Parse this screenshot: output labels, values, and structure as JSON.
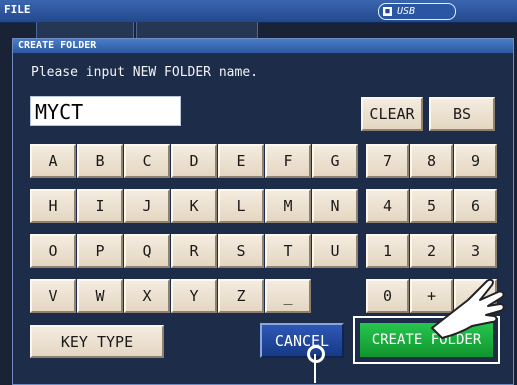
{
  "topbar": {
    "title": "FILE",
    "storage_label": "USB",
    "storage_icon": "usb-drive-icon"
  },
  "dialog": {
    "title": "CREATE FOLDER",
    "prompt": "Please input NEW FOLDER name.",
    "name_value": "MYCT"
  },
  "keys": {
    "letters": [
      "A",
      "B",
      "C",
      "D",
      "E",
      "F",
      "G",
      "H",
      "I",
      "J",
      "K",
      "L",
      "M",
      "N",
      "O",
      "P",
      "Q",
      "R",
      "S",
      "T",
      "U",
      "V",
      "W",
      "X",
      "Y",
      "Z",
      "_"
    ],
    "digits": [
      "7",
      "8",
      "9",
      "4",
      "5",
      "6",
      "1",
      "2",
      "3",
      "0",
      "+",
      ""
    ],
    "clear_label": "CLEAR",
    "bs_label": "BS",
    "key_type_label": "KEY TYPE"
  },
  "actions": {
    "cancel_label": "CANCEL",
    "create_label": "CREATE FOLDER"
  },
  "colors": {
    "create_button": "#1aa83e",
    "cancel_button": "#1f46a0",
    "key_face": "#efe4d4"
  }
}
